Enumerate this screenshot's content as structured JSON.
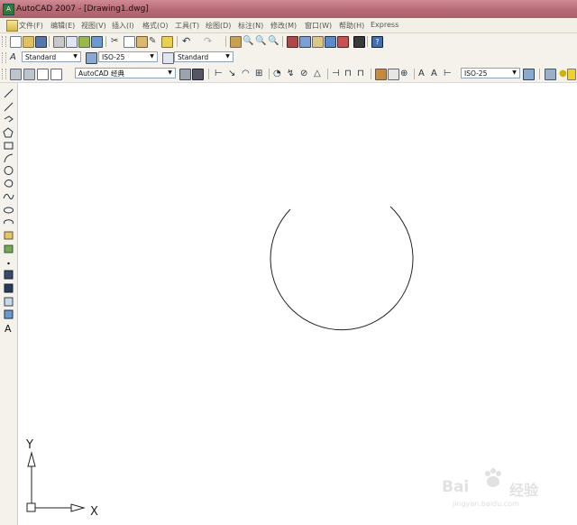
{
  "window": {
    "title": "AutoCAD 2007 - [Drawing1.dwg]",
    "icon": "acad-logo-icon"
  },
  "menubar": {
    "items": [
      "文件(F)",
      "编辑(E)",
      "视图(V)",
      "插入(I)",
      "格式(O)",
      "工具(T)",
      "绘图(D)",
      "标注(N)",
      "修改(M)",
      "窗口(W)",
      "帮助(H)",
      "Express"
    ]
  },
  "styles_toolbar": {
    "text_style": "Standard",
    "dim_style": "ISO-25",
    "table_style": "Standard"
  },
  "workspace_toolbar": {
    "workspace": "AutoCAD 经典",
    "dim_style": "ISO-25"
  },
  "ucs_icon": {
    "x_label": "X",
    "y_label": "Y"
  },
  "watermark": {
    "brand": "Bai",
    "brand_cn": "经验",
    "url": "jingyan.baidu.com"
  },
  "colors": {
    "titlebar": "#b86a75",
    "toolbar_bg": "#f4f2ea",
    "canvas_bg": "#ffffff"
  }
}
